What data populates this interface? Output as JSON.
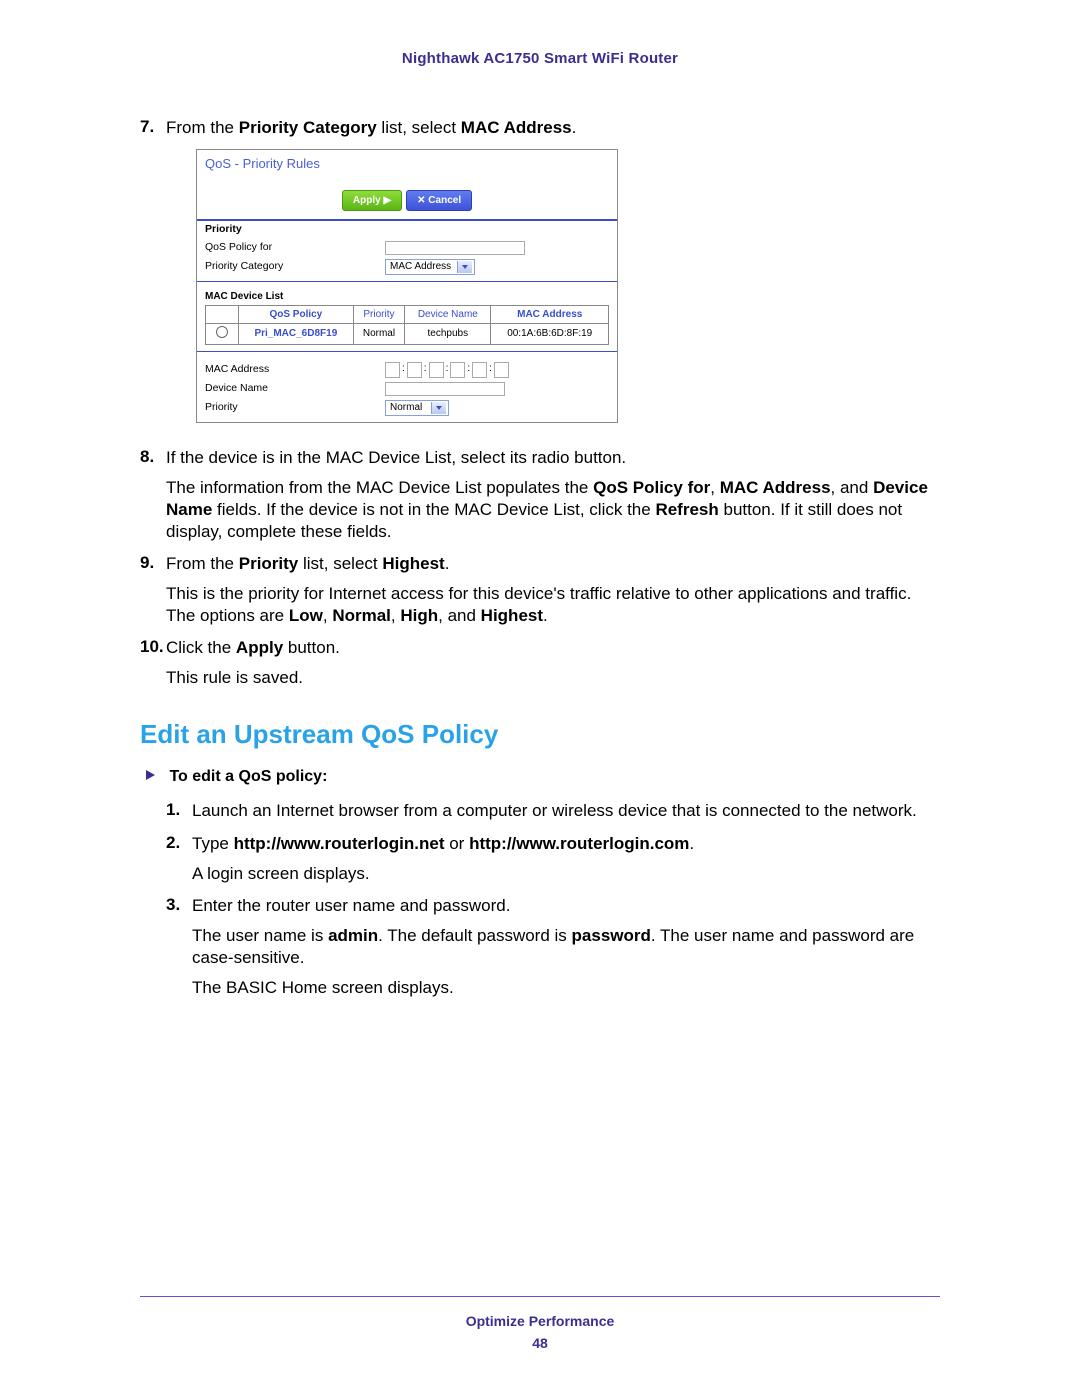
{
  "header": {
    "title": "Nighthawk AC1750 Smart WiFi Router"
  },
  "steps_a": [
    {
      "n": "7.",
      "parts": [
        "From the ",
        {
          "b": "Priority Category"
        },
        " list, select ",
        {
          "b": "MAC Address"
        },
        "."
      ]
    },
    {
      "n": "8.",
      "parts": [
        "If the device is in the MAC Device List, select its radio button."
      ],
      "cont": [
        "The information from the MAC Device List populates the ",
        {
          "b": "QoS Policy for"
        },
        ", ",
        {
          "b": "MAC Address"
        },
        ", and ",
        {
          "b": "Device Name"
        },
        " fields. If the device is not in the MAC Device List, click the ",
        {
          "b": "Refresh"
        },
        " button. If it still does not display, complete these fields."
      ]
    },
    {
      "n": "9.",
      "parts": [
        "From the ",
        {
          "b": "Priority"
        },
        " list, select ",
        {
          "b": "Highest"
        },
        "."
      ],
      "cont": [
        "This is the priority for Internet access for this device's traffic relative to other applications and traffic. The options are ",
        {
          "b": "Low"
        },
        ", ",
        {
          "b": "Normal"
        },
        ", ",
        {
          "b": "High"
        },
        ", and ",
        {
          "b": "Highest"
        },
        "."
      ]
    },
    {
      "n": "10.",
      "parts": [
        "Click the ",
        {
          "b": "Apply"
        },
        " button."
      ],
      "cont": [
        "This rule is saved."
      ]
    }
  ],
  "screenshot": {
    "title": "QoS - Priority Rules",
    "apply": "Apply ▶",
    "cancel": "✕ Cancel",
    "labels": {
      "priority": "Priority",
      "qos_for": "QoS Policy for",
      "pcat": "Priority Category",
      "pcat_val": "MAC Address",
      "mdl": "MAC Device List",
      "mac": "MAC Address",
      "dname": "Device Name",
      "pri": "Priority",
      "pri_val": "Normal"
    },
    "table": {
      "headers": [
        "",
        "QoS Policy",
        "Priority",
        "Device Name",
        "MAC Address"
      ],
      "row": [
        "",
        "Pri_MAC_6D8F19",
        "Normal",
        "techpubs",
        "00:1A:6B:6D:8F:19"
      ]
    }
  },
  "section": {
    "title": "Edit an Upstream QoS Policy"
  },
  "task": {
    "title": "To edit a QoS policy:"
  },
  "steps_b": [
    {
      "n": "1.",
      "parts": [
        "Launch an Internet browser from a computer or wireless device that is connected to the network."
      ]
    },
    {
      "n": "2.",
      "parts": [
        "Type ",
        {
          "b": "http://www.routerlogin.net"
        },
        " or ",
        {
          "b": "http://www.routerlogin.com"
        },
        "."
      ],
      "cont": [
        "A login screen displays."
      ]
    },
    {
      "n": "3.",
      "parts": [
        "Enter the router user name and password."
      ],
      "cont": [
        "The user name is ",
        {
          "b": "admin"
        },
        ". The default password is ",
        {
          "b": "password"
        },
        ". The user name and password are case-sensitive."
      ],
      "cont2": [
        "The BASIC Home screen displays."
      ]
    }
  ],
  "footer": {
    "text": "Optimize Performance",
    "page": "48"
  }
}
